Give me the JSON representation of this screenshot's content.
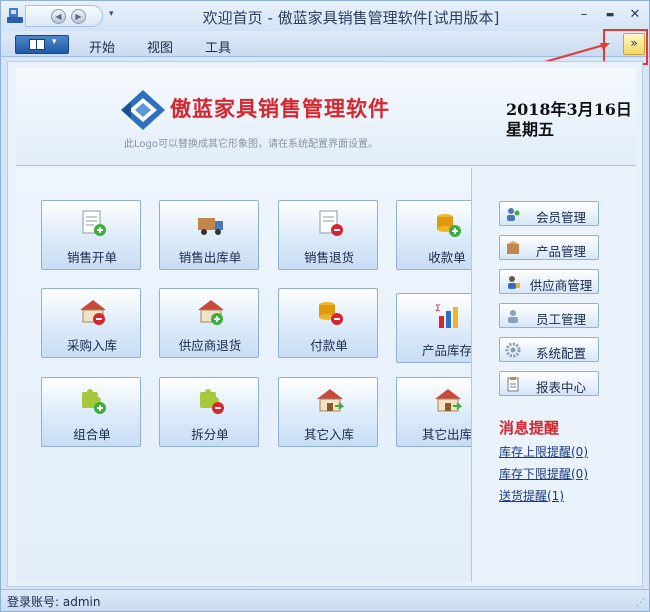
{
  "titlebar": {
    "title": "欢迎首页 - 傲蓝家具销售管理软件[试用版本]",
    "back_icon": "back-arrow-icon",
    "forward_icon": "forward-arrow-icon",
    "qa_dropdown": "▾",
    "minimize": "–",
    "maximize": "▬",
    "close": "✕"
  },
  "ribbon": {
    "tabs": [
      "开始",
      "视图",
      "工具"
    ],
    "expand_label": "»"
  },
  "annotation": {
    "marker": "①",
    "color": "#e53935"
  },
  "header": {
    "logo_text": "傲蓝家具销售管理软件",
    "logo_note": "此Logo可以替换成其它形象图，请在系统配置界面设置。",
    "date": "2018年3月16日",
    "weekday": "星期五"
  },
  "tiles": [
    {
      "label": "销售开单",
      "icon": "sales-document-icon"
    },
    {
      "label": "销售出库单",
      "icon": "delivery-truck-icon"
    },
    {
      "label": "销售退货",
      "icon": "sales-return-icon"
    },
    {
      "label": "收款单",
      "icon": "coins-add-icon"
    },
    {
      "label": "采购入库",
      "icon": "warehouse-in-icon"
    },
    {
      "label": "供应商退货",
      "icon": "supplier-return-icon"
    },
    {
      "label": "付款单",
      "icon": "coins-pay-icon"
    },
    {
      "label": "产品库存",
      "icon": "bar-chart-icon"
    },
    {
      "label": "组合单",
      "icon": "puzzle-add-icon"
    },
    {
      "label": "拆分单",
      "icon": "puzzle-remove-icon"
    },
    {
      "label": "其它入库",
      "icon": "house-in-icon"
    },
    {
      "label": "其它出库",
      "icon": "house-out-icon"
    }
  ],
  "side": {
    "buttons": [
      {
        "label": "会员管理",
        "icon": "members-icon"
      },
      {
        "label": "产品管理",
        "icon": "product-box-icon"
      },
      {
        "label": "供应商管理",
        "icon": "supplier-icon"
      },
      {
        "label": "员工管理",
        "icon": "employee-icon"
      },
      {
        "label": "系统配置",
        "icon": "gear-icon"
      },
      {
        "label": "报表中心",
        "icon": "report-icon"
      }
    ],
    "messages_title": "消息提醒",
    "messages": [
      "库存上限提醒(0)",
      "库存下限提醒(0)",
      "送货提醒(1)"
    ]
  },
  "status": {
    "login_text": "登录账号: admin"
  },
  "colors": {
    "accent_red": "#d8262f",
    "link_blue": "#1b3a8a",
    "tile_border": "#8fb2dc"
  }
}
